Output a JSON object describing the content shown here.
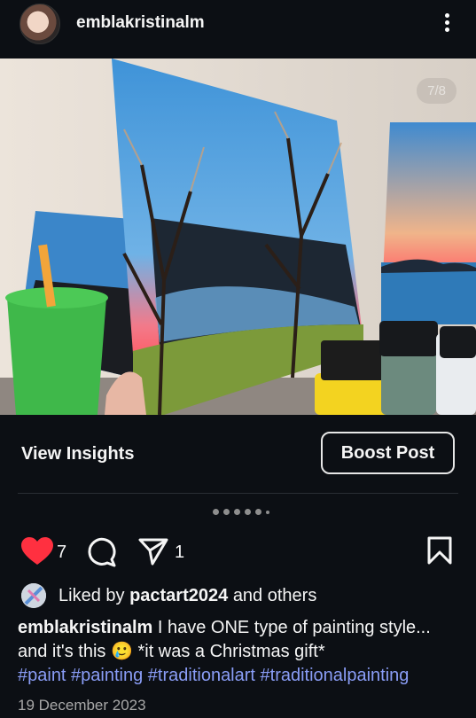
{
  "post": {
    "username": "emblakristinalm",
    "image_counter": "7/8",
    "carousel_total": 6,
    "carousel_active": 5
  },
  "actions": {
    "view_insights": "View Insights",
    "boost_post": "Boost Post"
  },
  "engagement": {
    "likes": "7",
    "shares": "1",
    "liked_by_prefix": "Liked by",
    "liked_by_user": "pactart2024",
    "liked_by_suffix": "and others"
  },
  "caption": {
    "author": "emblakristinalm",
    "text": "I have ONE type of painting style... and it's this",
    "emoji": "🥲",
    "text_after": "*it was a Christmas gift*",
    "hashtags": "#paint #painting #traditionalart #traditionalpainting"
  },
  "date": "19 December 2023",
  "colors": {
    "background": "#0c0f14",
    "like_red": "#ff3040",
    "hashtag_blue": "#8a9df6"
  },
  "icons": [
    "more-vertical-icon",
    "heart-icon",
    "comment-icon",
    "share-icon",
    "bookmark-icon"
  ]
}
